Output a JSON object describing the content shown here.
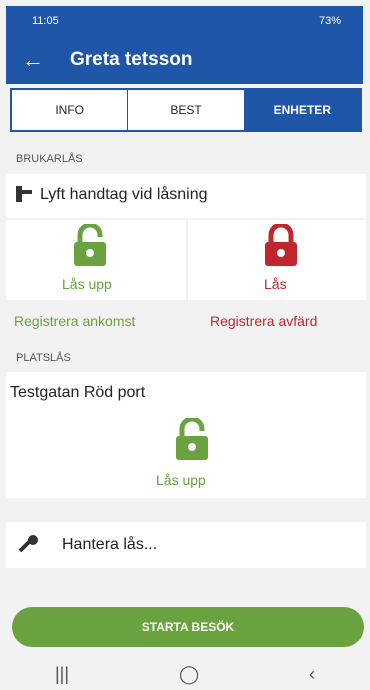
{
  "status": {
    "time": "11:05",
    "right": "73%"
  },
  "header": {
    "title": "Greta tetsson",
    "back": "←"
  },
  "tabs": [
    {
      "label": "INFO"
    },
    {
      "label": "BEST"
    },
    {
      "label": "ENHETER"
    }
  ],
  "brukarlas": {
    "section": "BRUKARLÅS",
    "lift_text": "Lyft handtag vid låsning",
    "unlock_label": "Lås upp",
    "lock_label": "Lås",
    "register_arrival": "Registrera ankomst",
    "register_departure": "Registrera avfärd"
  },
  "platslas": {
    "section": "PLATSLÅS",
    "place": "Testgatan Röd port",
    "unlock_label": "Lås upp"
  },
  "manage": {
    "label": "Hantera lås..."
  },
  "start_button": {
    "label": "STARTA BESÖK"
  },
  "colors": {
    "primary": "#1f56a8",
    "green": "#6aa23f",
    "red": "#c0262d"
  }
}
